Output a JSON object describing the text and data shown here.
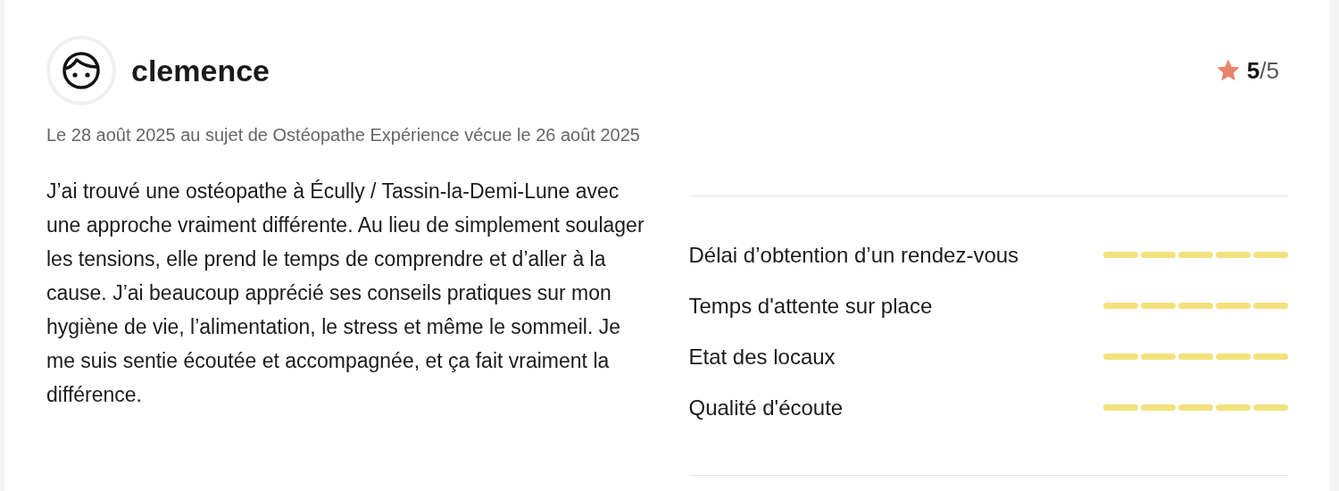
{
  "review": {
    "author": "clemence",
    "rating": "**5**/5",
    "meta": "Le 28 août 2025 au sujet de Ostéopathe Expérience vécue le 26 août 2025",
    "text": "J’ai trouvé une ostéopathe à Écully / Tassin-la-Demi-Lune avec une approche vraiment différente. Au lieu de simplement soulager les tensions, elle prend le temps de comprendre et d’aller à la cause. J’ai beaucoup apprécié ses conseils pratiques sur mon hygiène de vie, l’alimentation, le stress et même le sommeil. Je me suis sentie écoutée et accompagnée, et ça fait vraiment la différence."
  },
  "criteria": [
    {
      "label": "Délai d’obtention d’un rendez-vous",
      "stars": 5
    },
    {
      "label": "Temps d'attente sur place",
      "stars": 5
    },
    {
      "label": "Etat des locaux",
      "stars": 5
    },
    {
      "label": "Qualité d'écoute",
      "stars": 5
    }
  ]
}
